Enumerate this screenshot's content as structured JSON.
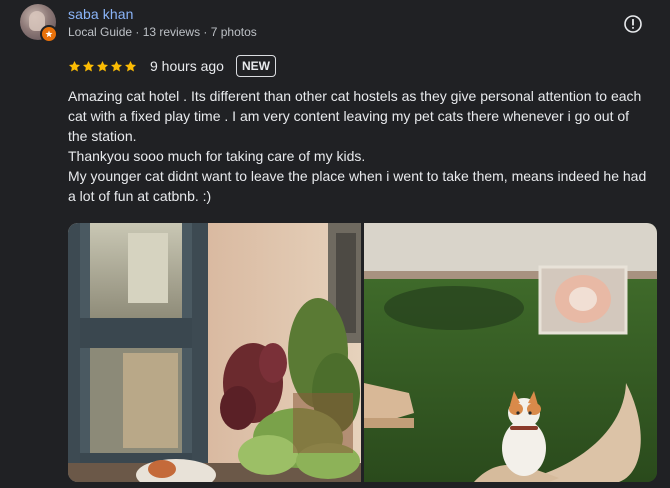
{
  "reviewer": {
    "name": "saba khan",
    "meta": "Local Guide · 13 reviews · 7 photos",
    "badge_color": "#e8710a"
  },
  "icons": {
    "more": "exclamation-circle-icon",
    "star": "star-icon",
    "badge": "local-guide-badge-icon"
  },
  "review": {
    "rating": 5,
    "rating_max": 5,
    "star_color": "#fbbc04",
    "time_ago": "9 hours ago",
    "new_label": "NEW",
    "text": "Amazing cat hotel . Its different than other cat hostels as they give personal attention to each cat with a fixed play time . I am very content leaving my pet cats there whenever i go out of the station.\nThankyou sooo much for taking care of my kids.\nMy younger cat didnt want to leave the place when i went to take them, means indeed he had a lot of fun at catbnb. :)"
  },
  "colors": {
    "background": "#202124",
    "name_link": "#8ab4f8",
    "text": "#e8eaed",
    "meta_text": "#bdc1c6"
  }
}
